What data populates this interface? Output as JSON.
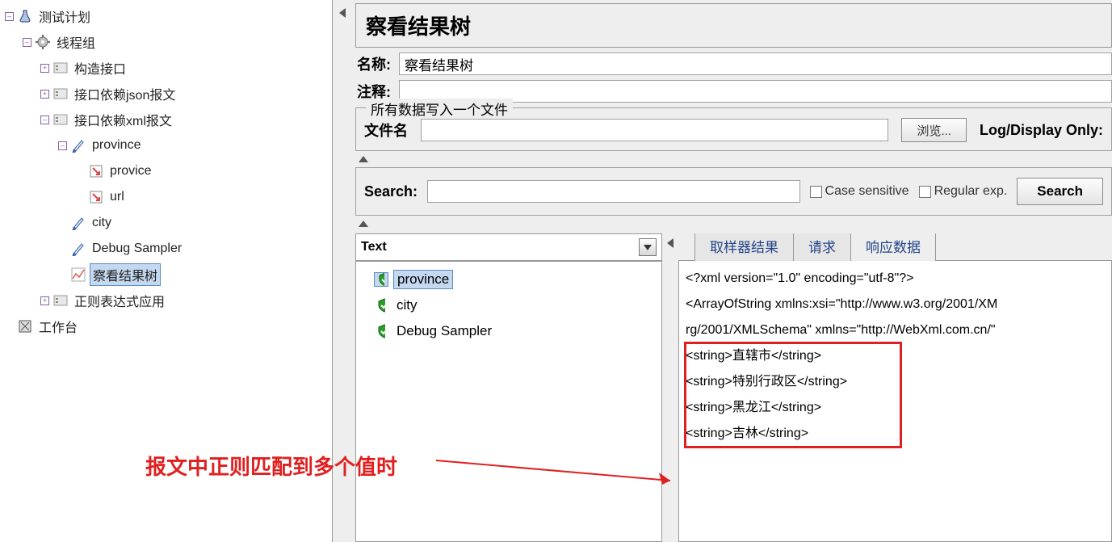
{
  "tree": {
    "root": "测试计划",
    "workbench": "工作台",
    "thread_group": "线程组",
    "children": {
      "constr": "构造接口",
      "json_dep": "接口依赖json报文",
      "xml_dep": "接口依赖xml报文",
      "province": "province",
      "province_sub1": "provice",
      "province_sub2": "url",
      "city": "city",
      "debug": "Debug Sampler",
      "view_tree": "察看结果树",
      "regex": "正则表达式应用"
    }
  },
  "panel_title": "察看结果树",
  "form": {
    "name_label": "名称:",
    "name_value": "察看结果树",
    "comment_label": "注释:",
    "comment_value": ""
  },
  "filegroup": {
    "title": "所有数据写入一个文件",
    "filename_label": "文件名",
    "filename_value": "",
    "browse": "浏览...",
    "logdisplay": "Log/Display Only:"
  },
  "search": {
    "label": "Search:",
    "value": "",
    "case_sensitive": "Case sensitive",
    "regex": "Regular exp.",
    "button": "Search"
  },
  "results": {
    "combo": "Text",
    "items": [
      "province",
      "city",
      "Debug Sampler"
    ]
  },
  "tabs": {
    "t1": "取样器结果",
    "t2": "请求",
    "t3": "响应数据"
  },
  "xml_lines": [
    "<?xml version=\"1.0\" encoding=\"utf-8\"?>",
    "<ArrayOfString xmlns:xsi=\"http://www.w3.org/2001/XM",
    "rg/2001/XMLSchema\" xmlns=\"http://WebXml.com.cn/\"",
    "  <string>直辖市</string>",
    "  <string>特别行政区</string>",
    "  <string>黑龙江</string>",
    "  <string>吉林</string>"
  ],
  "annotation": "报文中正则匹配到多个值时"
}
